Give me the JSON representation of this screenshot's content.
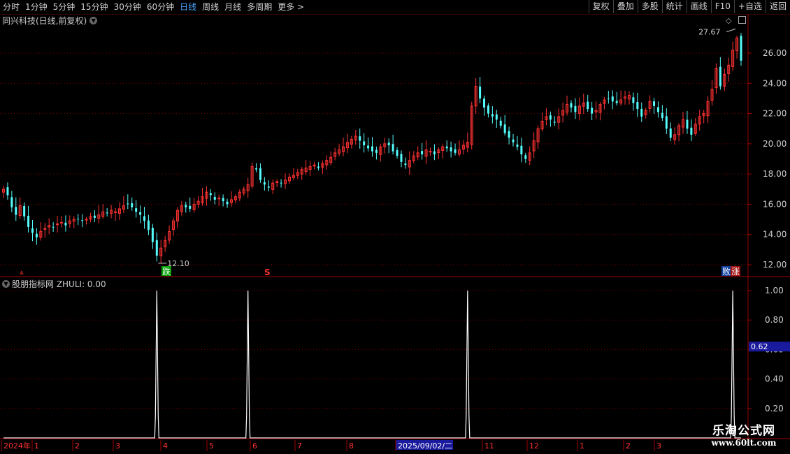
{
  "toolbar": {
    "periods": [
      "分时",
      "1分钟",
      "5分钟",
      "15分钟",
      "30分钟",
      "60分钟",
      "日线",
      "周线",
      "月线",
      "多周期",
      "更多 >"
    ],
    "active_period": "日线",
    "buttons": [
      "复权",
      "叠加",
      "多股",
      "统计",
      "画线",
      "F10",
      "+自选",
      "返回"
    ]
  },
  "main_chart": {
    "caption": "同兴科技(日线,前复权)",
    "price_ticks": [
      "26.00",
      "24.00",
      "22.00",
      "20.00",
      "18.00",
      "16.00",
      "14.00",
      "12.00"
    ],
    "high_label": "27.67",
    "low_label": "12.10",
    "markers": {
      "die": "跌",
      "s": "S",
      "bai": "败",
      "zhang": "涨"
    }
  },
  "indicator": {
    "caption": "股朋指标网 ZHULI: 0.00",
    "ticks": [
      "1.00",
      "0.80",
      "0.60",
      "0.40",
      "0.20"
    ],
    "current_value": "0.62"
  },
  "time_axis": {
    "labels": [
      "2024年",
      "1",
      "2",
      "3",
      "4",
      "5",
      "6",
      "7",
      "8",
      "2025/09/02/二",
      "11",
      "12",
      "1",
      "2",
      "3"
    ]
  },
  "watermark": {
    "line1": "乐淘公式网",
    "line2": "www.60lt.com"
  },
  "colors": {
    "up": "#ff3232",
    "down": "#54fcfc",
    "grid": "#7a0000",
    "accent": "#4aa3ff",
    "highlight": "#1a1a9e"
  },
  "chart_data": [
    {
      "type": "candlestick",
      "title": "同兴科技(日线,前复权)",
      "ylim": [
        11.5,
        28.5
      ],
      "y_ticks": [
        12,
        14,
        16,
        18,
        20,
        22,
        24,
        26
      ],
      "annotations": [
        {
          "label": "27.67",
          "value": 27.67
        },
        {
          "label": "12.10",
          "value": 12.1
        }
      ],
      "closes": [
        17.0,
        16.6,
        15.8,
        15.3,
        15.9,
        15.2,
        14.5,
        14.1,
        13.8,
        14.2,
        14.4,
        14.6,
        14.5,
        14.7,
        14.8,
        14.6,
        14.9,
        15.0,
        15.0,
        14.9,
        15.0,
        15.2,
        15.1,
        15.3,
        15.5,
        15.4,
        15.6,
        15.5,
        15.7,
        15.9,
        16.0,
        15.8,
        15.5,
        15.3,
        14.9,
        14.3,
        13.5,
        12.6,
        13.1,
        13.6,
        14.2,
        14.9,
        15.6,
        15.9,
        15.8,
        15.7,
        16.0,
        16.2,
        16.5,
        16.8,
        16.6,
        16.3,
        16.4,
        16.2,
        16.0,
        16.3,
        16.5,
        16.8,
        17.0,
        17.3,
        18.5,
        18.3,
        17.6,
        17.3,
        17.1,
        17.4,
        17.5,
        17.4,
        17.6,
        17.8,
        17.9,
        18.1,
        18.3,
        18.4,
        18.5,
        18.6,
        18.4,
        18.7,
        18.9,
        19.1,
        19.4,
        19.6,
        19.8,
        20.1,
        20.3,
        20.5,
        20.2,
        19.9,
        19.7,
        19.5,
        19.4,
        19.8,
        20.0,
        19.9,
        19.5,
        19.2,
        18.8,
        18.6,
        18.9,
        19.2,
        19.4,
        19.3,
        19.6,
        19.5,
        19.3,
        19.6,
        19.8,
        19.7,
        19.5,
        19.4,
        19.6,
        19.9,
        20.1,
        22.5,
        23.8,
        23.0,
        22.4,
        22.0,
        21.8,
        21.6,
        21.2,
        20.7,
        20.4,
        20.1,
        19.8,
        19.3,
        19.0,
        19.4,
        20.2,
        21.0,
        21.5,
        21.8,
        21.6,
        21.4,
        21.8,
        22.2,
        22.6,
        22.4,
        22.1,
        22.5,
        22.7,
        22.3,
        22.0,
        22.2,
        22.6,
        22.9,
        23.0,
        22.8,
        22.7,
        22.9,
        23.1,
        23.2,
        22.7,
        22.3,
        21.8,
        22.2,
        22.8,
        22.5,
        22.1,
        21.7,
        21.0,
        20.4,
        20.6,
        21.2,
        21.6,
        21.0,
        20.6,
        21.3,
        21.8,
        22.0,
        22.8,
        23.6,
        25.0,
        23.8,
        24.6,
        25.2,
        26.2,
        27.0,
        25.5
      ]
    },
    {
      "type": "line",
      "title": "股朋指标网 ZHULI",
      "series": [
        {
          "name": "ZHULI"
        }
      ],
      "ylim": [
        0,
        1.05
      ],
      "y_ticks": [
        0.2,
        0.4,
        0.6,
        0.8,
        1.0
      ],
      "current_value": 0.62,
      "baseline": 0,
      "peaks": [
        {
          "index": 37,
          "value": 1.0
        },
        {
          "index": 59,
          "value": 1.0
        },
        {
          "index": 112,
          "value": 1.0
        },
        {
          "index": 176,
          "value": 1.0
        }
      ]
    }
  ]
}
